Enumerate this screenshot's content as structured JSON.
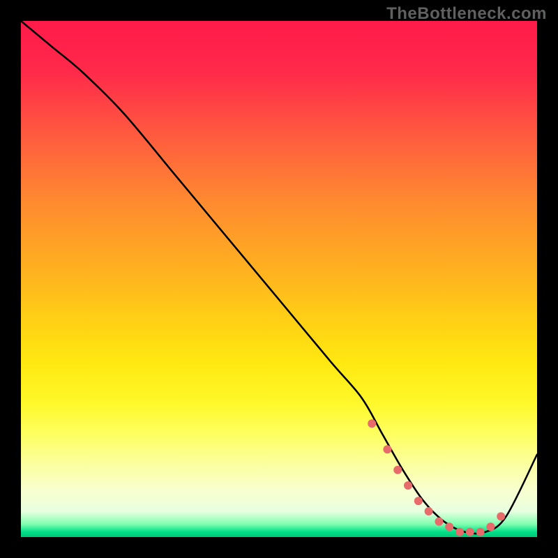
{
  "watermark": "TheBottleneck.com",
  "chart_data": {
    "type": "line",
    "title": "",
    "xlabel": "",
    "ylabel": "",
    "xlim": [
      0,
      100
    ],
    "ylim": [
      0,
      100
    ],
    "series": [
      {
        "name": "bottleneck-curve",
        "x": [
          0,
          6,
          12,
          20,
          30,
          40,
          50,
          60,
          66,
          70,
          74,
          78,
          82,
          86,
          90,
          94,
          100
        ],
        "y": [
          100,
          95,
          90,
          82,
          70,
          58,
          46,
          34,
          27,
          20,
          13,
          7,
          3,
          1,
          1,
          4,
          16
        ]
      }
    ],
    "markers": {
      "name": "highlight-dots",
      "color": "#e86b6b",
      "x": [
        68,
        71,
        73,
        75,
        77,
        79,
        81,
        83,
        85,
        87,
        89,
        91,
        93
      ],
      "y": [
        22,
        17,
        13,
        10,
        7,
        5,
        3,
        2,
        1,
        1,
        1,
        2,
        4
      ]
    },
    "gradient_stops": [
      {
        "pos": 0.0,
        "color": "#ff1a4a"
      },
      {
        "pos": 0.35,
        "color": "#ff8a30"
      },
      {
        "pos": 0.66,
        "color": "#ffe810"
      },
      {
        "pos": 0.95,
        "color": "#e8ffe0"
      },
      {
        "pos": 1.0,
        "color": "#00c878"
      }
    ]
  }
}
